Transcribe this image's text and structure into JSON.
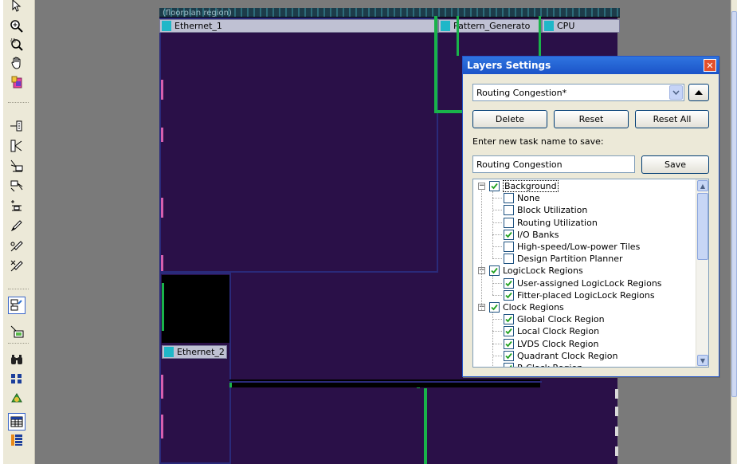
{
  "toolbar": {
    "icons": [
      "selection-icon",
      "zoom-in-icon",
      "zoom-region-icon",
      "hand-icon",
      "layers-icon",
      "node-icon",
      "path-icon",
      "fanin-icon",
      "fanout-icon",
      "connection-icon",
      "edit-icon",
      "route-icon",
      "delete-route-icon",
      "assignment-icon",
      "display-icon",
      "find-icon",
      "blocks-icon",
      "fitter-icon",
      "table-icon",
      "list-icon"
    ]
  },
  "regions": {
    "top_header_partial": "(floorplan region)",
    "ethernet_1": "Ethernet_1",
    "pattern_generator": "Pattern_Generato",
    "cpu": "CPU",
    "ethernet_2": "Ethernet_2"
  },
  "dialog": {
    "title": "Layers Settings",
    "close": "✕",
    "preset_value": "Routing Congestion*",
    "delete_label": "Delete",
    "reset_label": "Reset",
    "reset_all_label": "Reset All",
    "task_prompt": "Enter new task name to save:",
    "task_name_value": "Routing Congestion",
    "save_label": "Save",
    "tree": [
      {
        "label": "Background",
        "level": 0,
        "checked": true,
        "expander": true
      },
      {
        "label": "None",
        "level": 1,
        "checked": false
      },
      {
        "label": "Block Utilization",
        "level": 1,
        "checked": false
      },
      {
        "label": "Routing Utilization",
        "level": 1,
        "checked": false
      },
      {
        "label": "I/O Banks",
        "level": 1,
        "checked": true
      },
      {
        "label": "High-speed/Low-power Tiles",
        "level": 1,
        "checked": false
      },
      {
        "label": "Design Partition Planner",
        "level": 1,
        "checked": false
      },
      {
        "label": "LogicLock Regions",
        "level": 0,
        "checked": true,
        "expander": true
      },
      {
        "label": "User-assigned LogicLock Regions",
        "level": 1,
        "checked": true
      },
      {
        "label": "Fitter-placed LogicLock Regions",
        "level": 1,
        "checked": true
      },
      {
        "label": "Clock Regions",
        "level": 0,
        "checked": true,
        "expander": true
      },
      {
        "label": "Global Clock Region",
        "level": 1,
        "checked": true
      },
      {
        "label": "Local Clock Region",
        "level": 1,
        "checked": true
      },
      {
        "label": "LVDS Clock Region",
        "level": 1,
        "checked": true
      },
      {
        "label": "Quadrant Clock Region",
        "level": 1,
        "checked": true
      },
      {
        "label": "R Clock Region",
        "level": 1,
        "checked": true
      }
    ]
  },
  "colors": {
    "canvas_background": "#7a7a7a",
    "region_fill": "#2a1048",
    "region_swatch": "#1fb7c8",
    "routing_line": "#19b34a",
    "dialog_title_bar": "#1b53c8"
  }
}
